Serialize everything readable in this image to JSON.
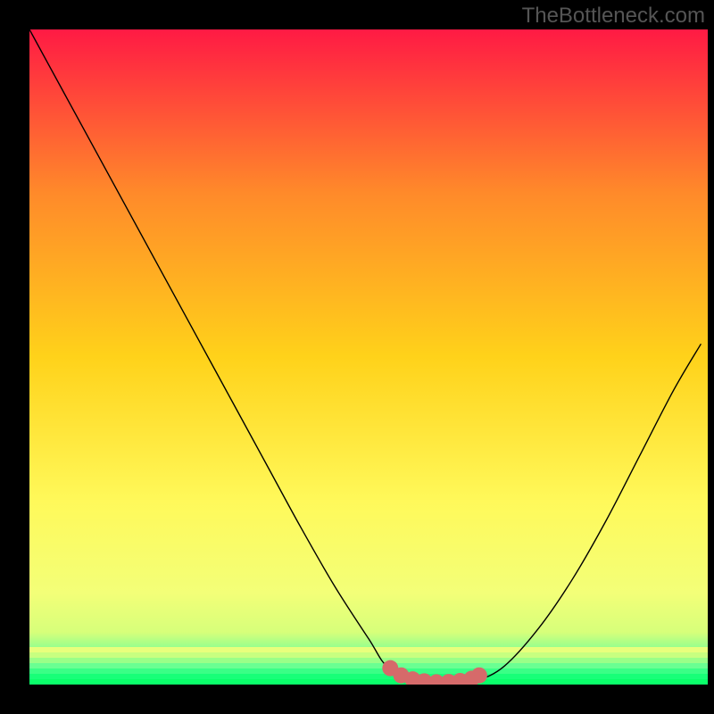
{
  "watermark": "TheBottleneck.com",
  "chart_data": {
    "type": "line",
    "title": "",
    "xlabel": "",
    "ylabel": "",
    "xlim": [
      0,
      100
    ],
    "ylim": [
      0,
      100
    ],
    "background_gradient": {
      "top": "#ff1a44",
      "upper_mid": "#ff8a2a",
      "mid": "#ffd21a",
      "lower_mid": "#fff95a",
      "lower": "#d7ff7a",
      "bottom_band1": "#6aff9a",
      "bottom_band2": "#2aff82",
      "bottom": "#0aff6a"
    },
    "series": [
      {
        "name": "curve",
        "color": "#000000",
        "width": 1.4,
        "x": [
          0,
          5,
          10,
          15,
          20,
          25,
          30,
          35,
          40,
          45,
          50,
          53,
          58,
          63,
          66,
          70,
          75,
          80,
          85,
          90,
          95,
          99
        ],
        "y": [
          100,
          90.5,
          81,
          71.5,
          62,
          52.5,
          43,
          33.5,
          24,
          15,
          7,
          2.5,
          0.4,
          0.3,
          0.6,
          2.8,
          8.5,
          16,
          25,
          35,
          45,
          52
        ]
      },
      {
        "name": "highlight-dots",
        "color": "#d66a6a",
        "type": "scatter",
        "size": 9,
        "x": [
          53.2,
          54.8,
          56.5,
          58.2,
          60.0,
          61.8,
          63.5,
          65.2,
          66.3
        ],
        "y": [
          2.5,
          1.4,
          0.8,
          0.5,
          0.35,
          0.4,
          0.55,
          0.9,
          1.4
        ]
      }
    ]
  }
}
